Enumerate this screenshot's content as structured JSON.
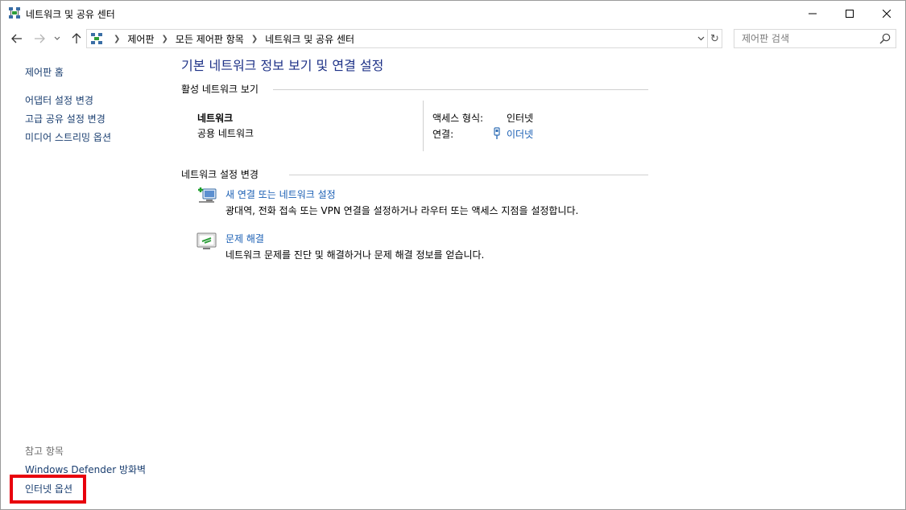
{
  "window": {
    "title": "네트워크 및 공유 센터"
  },
  "nav": {
    "breadcrumbs": [
      "제어판",
      "모든 제어판 항목",
      "네트워크 및 공유 센터"
    ],
    "search_placeholder": "제어판 검색"
  },
  "sidebar": {
    "home": "제어판 홈",
    "items": [
      "어댑터 설정 변경",
      "고급 공유 설정 변경",
      "미디어 스트리밍 옵션"
    ],
    "see_also_title": "참고 항목",
    "see_also": [
      "Windows Defender 방화벽",
      "인터넷 옵션"
    ]
  },
  "main": {
    "title": "기본 네트워크 정보 보기 및 연결 설정",
    "active_section": "활성 네트워크 보기",
    "network_name": "네트워크",
    "network_type": "공용 네트워크",
    "access_type_label": "액세스 형식:",
    "access_type_value": "인터넷",
    "connection_label": "연결:",
    "connection_value": "이더넷",
    "change_section": "네트워크 설정 변경",
    "tasks": [
      {
        "title": "새 연결 또는 네트워크 설정",
        "desc": "광대역, 전화 접속 또는 VPN 연결을 설정하거나 라우터 또는 액세스 지점을 설정합니다."
      },
      {
        "title": "문제 해결",
        "desc": "네트워크 문제를 진단 및 해결하거나 문제 해결 정보를 얻습니다."
      }
    ]
  },
  "colors": {
    "link": "#1a5fb4",
    "title": "#1e3287",
    "highlight": "#e8000d"
  }
}
